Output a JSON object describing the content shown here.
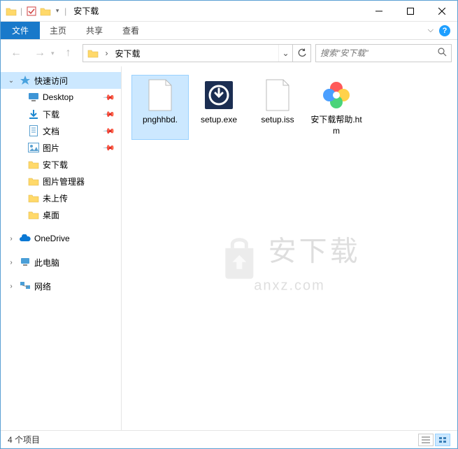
{
  "title": "安下载",
  "ribbon": {
    "file": "文件",
    "home": "主页",
    "share": "共享",
    "view": "查看"
  },
  "address": {
    "current": "安下载"
  },
  "search": {
    "placeholder": "搜索\"安下载\""
  },
  "sidebar": {
    "quick_access": "快速访问",
    "items": [
      {
        "label": "Desktop",
        "pinned": true,
        "icon": "desktop"
      },
      {
        "label": "下载",
        "pinned": true,
        "icon": "downloads"
      },
      {
        "label": "文档",
        "pinned": true,
        "icon": "documents"
      },
      {
        "label": "图片",
        "pinned": true,
        "icon": "pictures"
      },
      {
        "label": "安下载",
        "pinned": false,
        "icon": "folder"
      },
      {
        "label": "图片管理器",
        "pinned": false,
        "icon": "folder"
      },
      {
        "label": "未上传",
        "pinned": false,
        "icon": "folder"
      },
      {
        "label": "桌面",
        "pinned": false,
        "icon": "folder"
      }
    ],
    "onedrive": "OneDrive",
    "thispc": "此电脑",
    "network": "网络"
  },
  "files": [
    {
      "name": "pnghhbd.",
      "type": "blank"
    },
    {
      "name": "setup.exe",
      "type": "installer"
    },
    {
      "name": "setup.iss",
      "type": "blank"
    },
    {
      "name": "安下载帮助.htm",
      "type": "pinwheel"
    }
  ],
  "status": {
    "count": "4 个项目"
  },
  "watermark": {
    "cn": "安下载",
    "en": "anxz.com"
  }
}
